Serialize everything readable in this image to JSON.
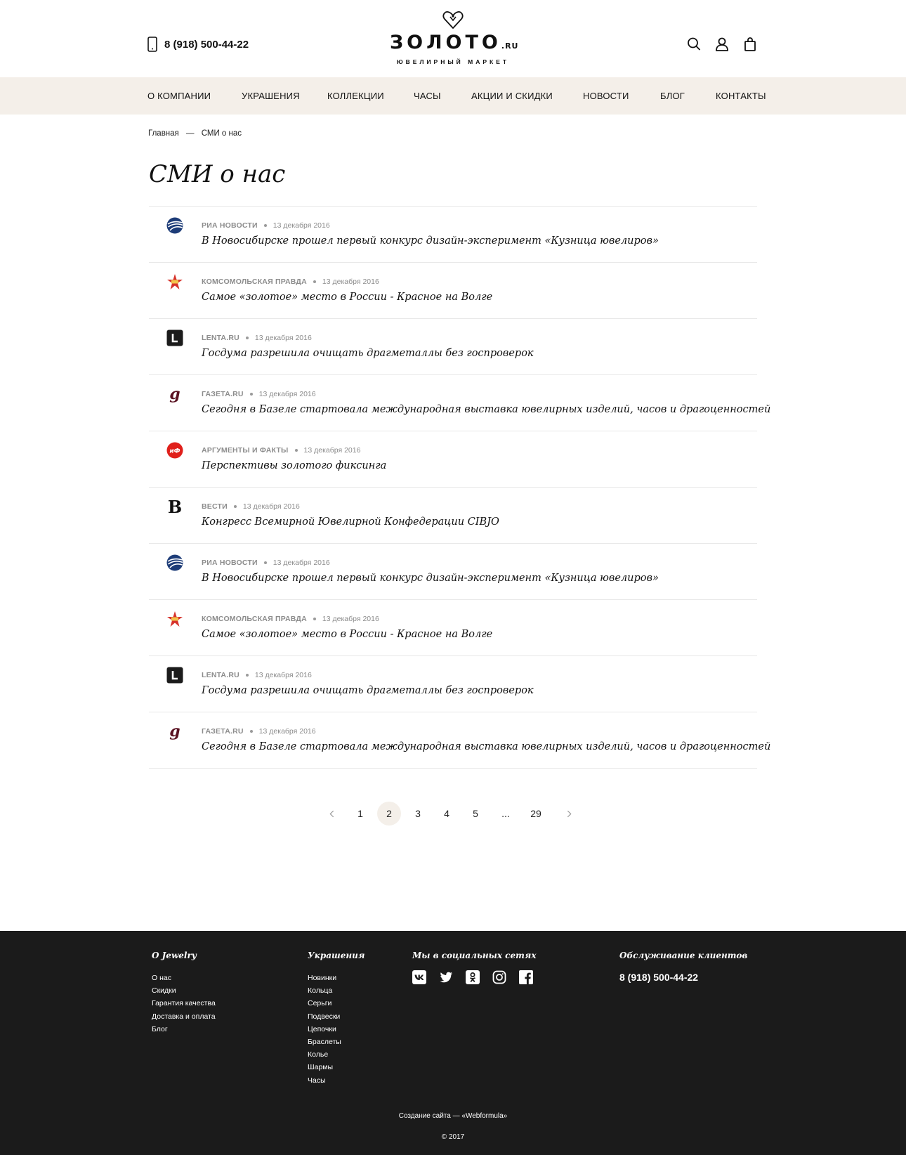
{
  "header": {
    "phone": "8 (918) 500-44-22",
    "logo_word": "ЗОЛОТО",
    "logo_suffix": ".RU",
    "logo_tagline": "ЮВЕЛИРНЫЙ МАРКЕТ"
  },
  "nav": {
    "items": [
      {
        "label": "О КОМПАНИИ"
      },
      {
        "label": "УКРАШЕНИЯ"
      },
      {
        "label": "КОЛЛЕКЦИИ"
      },
      {
        "label": "ЧАСЫ"
      },
      {
        "label": "АКЦИИ И СКИДКИ"
      },
      {
        "label": "НОВОСТИ"
      },
      {
        "label": "БЛОГ"
      },
      {
        "label": "КОНТАКТЫ"
      }
    ]
  },
  "breadcrumb": {
    "home": "Главная",
    "separator": "—",
    "current": "СМИ о нас"
  },
  "page": {
    "title": "СМИ о нас"
  },
  "articles": [
    {
      "source": "РИА НОВОСТИ",
      "logo": "ria-logo-icon",
      "date": "13 декабря 2016",
      "title": "В Новосибирске прошел первый конкурс дизайн-эксперимент «Кузница ювелиров»"
    },
    {
      "source": "КОМСОМОЛЬСКАЯ ПРАВДА",
      "logo": "kp-logo-icon",
      "date": "13 декабря 2016",
      "title": "Самое «золотое» место в России - Красное на Волге"
    },
    {
      "source": "LENTA.RU",
      "logo": "lenta-logo-icon",
      "date": "13 декабря 2016",
      "title": "Госдума разрешила очищать драгметаллы без госпроверок"
    },
    {
      "source": "ГАЗЕТА.RU",
      "logo": "gazeta-logo-icon",
      "date": "13 декабря 2016",
      "title": "Сегодня в Базеле стартовала международная выставка ювелирных изделий, часов и драгоценностей"
    },
    {
      "source": "АРГУМЕНТЫ И ФАКТЫ",
      "logo": "aif-logo-icon",
      "date": "13 декабря 2016",
      "title": "Перспективы золотого фиксинга"
    },
    {
      "source": "ВЕСТИ",
      "logo": "vesti-logo-icon",
      "date": "13 декабря 2016",
      "title": "Конгресс Всемирной Ювелирной Конфедерации CIBJO"
    },
    {
      "source": "РИА НОВОСТИ",
      "logo": "ria-logo-icon",
      "date": "13 декабря 2016",
      "title": "В Новосибирске прошел первый конкурс дизайн-эксперимент «Кузница ювелиров»"
    },
    {
      "source": "КОМСОМОЛЬСКАЯ ПРАВДА",
      "logo": "kp-logo-icon",
      "date": "13 декабря 2016",
      "title": "Самое «золотое» место в России - Красное на Волге"
    },
    {
      "source": "LENTA.RU",
      "logo": "lenta-logo-icon",
      "date": "13 декабря 2016",
      "title": "Госдума разрешила очищать драгметаллы без госпроверок"
    },
    {
      "source": "ГАЗЕТА.RU",
      "logo": "gazeta-logo-icon",
      "date": "13 декабря 2016",
      "title": "Сегодня в Базеле стартовала международная выставка ювелирных изделий, часов и драгоценностей"
    }
  ],
  "pagination": {
    "pages": [
      "1",
      "2",
      "3",
      "4",
      "5",
      "...",
      "29"
    ],
    "current": "2"
  },
  "footer": {
    "about": {
      "heading": "О Jewelry",
      "links": [
        "О нас",
        "Скидки",
        "Гарантия качества",
        "Доставка и оплата",
        "Блог"
      ]
    },
    "jewelry": {
      "heading": "Украшения",
      "links": [
        "Новинки",
        "Кольца",
        "Серьги",
        "Подвески",
        "Цепочки",
        "Браслеты",
        "Колье",
        "Шармы",
        "Часы"
      ]
    },
    "social": {
      "heading": "Мы в социальных сетях",
      "icons": [
        "vk-icon",
        "twitter-icon",
        "odnoklassniki-icon",
        "instagram-icon",
        "facebook-icon"
      ]
    },
    "service": {
      "heading": "Обслуживание клиентов",
      "phone": "8 (918) 500-44-22"
    },
    "credits": "Создание сайта — «Webformula»",
    "copyright": "© 2017"
  },
  "colors": {
    "nav_bg": "#f4efe9",
    "footer_bg": "#1b1b1b",
    "meta_text": "#8c8c8c",
    "divider": "#e8e8e8"
  }
}
